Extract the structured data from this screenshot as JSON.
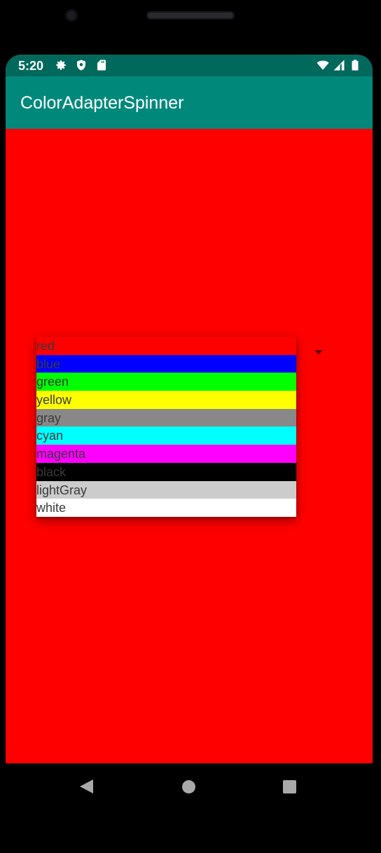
{
  "status_bar": {
    "time": "5:20",
    "icons_left": [
      "gear-icon",
      "shield-icon",
      "sd-card-icon"
    ],
    "icons_right": [
      "wifi-icon",
      "cell-signal-icon",
      "battery-icon"
    ]
  },
  "app_bar": {
    "title": "ColorAdapterSpinner",
    "color": "#00897b",
    "status_color": "#00695c"
  },
  "content": {
    "background": "#ff0000"
  },
  "spinner": {
    "selected": "red",
    "items": [
      {
        "label": "red",
        "color": "#ff0000"
      },
      {
        "label": "blue",
        "color": "#0000ff"
      },
      {
        "label": "green",
        "color": "#00ff00"
      },
      {
        "label": "yellow",
        "color": "#ffff00"
      },
      {
        "label": "gray",
        "color": "#888888"
      },
      {
        "label": "cyan",
        "color": "#00ffff"
      },
      {
        "label": "magenta",
        "color": "#ff00ff"
      },
      {
        "label": "black",
        "color": "#000000"
      },
      {
        "label": "lightGray",
        "color": "#cccccc"
      },
      {
        "label": "white",
        "color": "#ffffff"
      }
    ]
  },
  "nav_bar": {
    "buttons": [
      "back-icon",
      "home-icon",
      "recents-icon"
    ]
  }
}
